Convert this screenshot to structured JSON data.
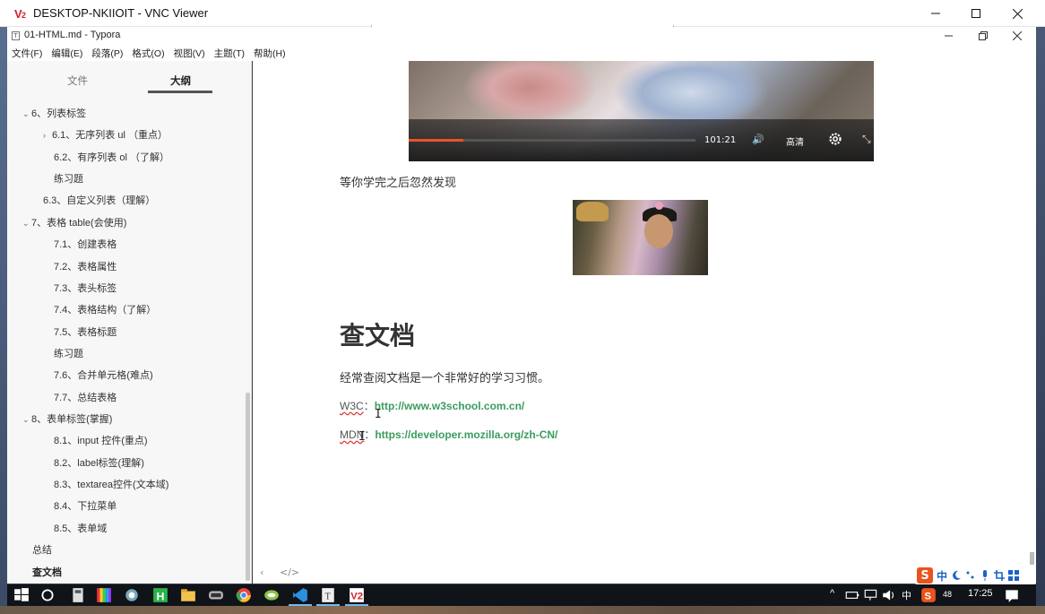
{
  "vnc": {
    "title": "DESKTOP-NKIIOIT - VNC Viewer",
    "logo_text": "V2",
    "minimize": "—",
    "maximize": "☐",
    "close": "✕"
  },
  "typora": {
    "title": "01-HTML.md - Typora",
    "icon_glyph": "T",
    "minimize": "—",
    "restore": "❐",
    "close": "✕",
    "menu": [
      "文件(F)",
      "编辑(E)",
      "段落(P)",
      "格式(O)",
      "视图(V)",
      "主题(T)",
      "帮助(H)"
    ]
  },
  "sidebar": {
    "tabs": [
      "文件",
      "大纲"
    ],
    "active_tab": "大纲",
    "outline": [
      {
        "label": "6、列表标签",
        "caret": "⌄"
      },
      {
        "label": "6.1、无序列表 ul （重点）",
        "caret": "›"
      },
      {
        "label": "6.2、有序列表 ol （了解）",
        "caret": ""
      },
      {
        "label": "练习题",
        "caret": ""
      },
      {
        "label": "6.3、自定义列表（理解）",
        "caret": ""
      },
      {
        "label": "7、表格 table(会使用)",
        "caret": "⌄"
      },
      {
        "label": "7.1、创建表格",
        "caret": ""
      },
      {
        "label": "7.2、表格属性",
        "caret": ""
      },
      {
        "label": "7.3、表头标签",
        "caret": ""
      },
      {
        "label": "7.4、表格结构（了解）",
        "caret": ""
      },
      {
        "label": "7.5、表格标题",
        "caret": ""
      },
      {
        "label": "练习题",
        "caret": ""
      },
      {
        "label": "7.6、合并单元格(难点)",
        "caret": ""
      },
      {
        "label": "7.7、总结表格",
        "caret": ""
      },
      {
        "label": "8、表单标签(掌握)",
        "caret": "⌄"
      },
      {
        "label": "8.1、input 控件(重点)",
        "caret": ""
      },
      {
        "label": "8.2、label标签(理解)",
        "caret": ""
      },
      {
        "label": "8.3、textarea控件(文本域)",
        "caret": ""
      },
      {
        "label": "8.4、下拉菜单",
        "caret": ""
      },
      {
        "label": "8.5、表单域",
        "caret": ""
      },
      {
        "label": "总结",
        "caret": ""
      },
      {
        "label": "查文档",
        "caret": ""
      }
    ]
  },
  "editor": {
    "video": {
      "time": "101:21",
      "quality": "高清",
      "volume_icon": "🔊",
      "fullscreen_icon": "⤡",
      "progress_fraction": 0.19
    },
    "para1": "等你学完之后忽然发现",
    "heading": "查文档",
    "para2": "经常查阅文档是一个非常好的学习习惯。",
    "w3c_label": "W3C",
    "w3c_sep": "：",
    "w3c_url": "http://www.w3school.com.cn/",
    "mdn_label": "MDN",
    "mdn_sep": "：",
    "mdn_url": "https://developer.mozilla.org/zh-CN/",
    "nav_back": "‹",
    "nav_source": "</>"
  },
  "ime": {
    "logo": "S",
    "mode": "中"
  },
  "taskbar": {
    "time": "17:25",
    "lang": "中",
    "badge": "48"
  }
}
